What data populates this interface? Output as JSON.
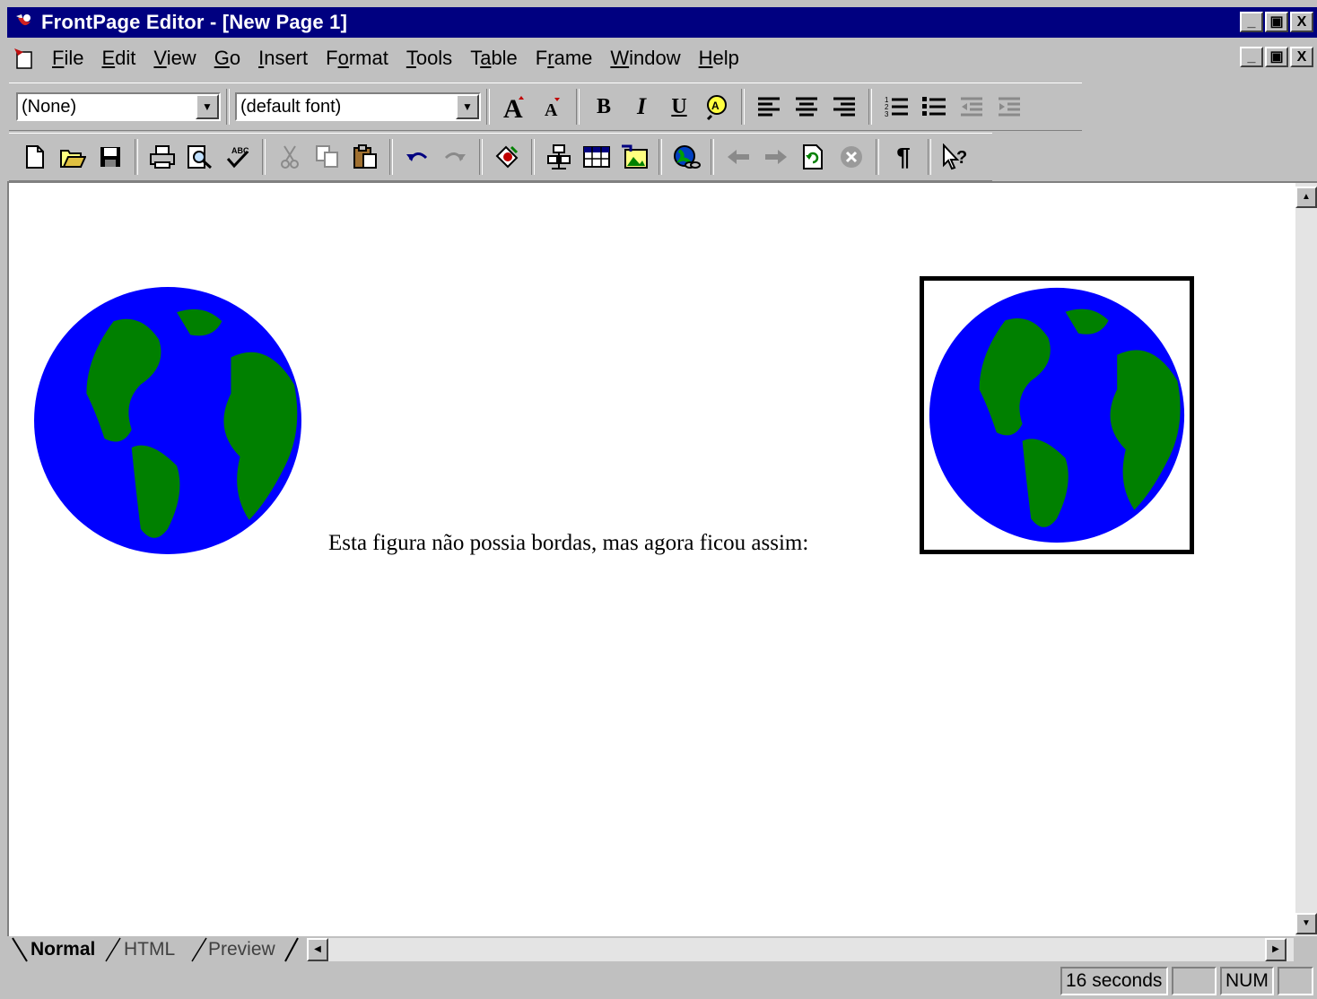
{
  "window": {
    "title": "FrontPage Editor - [New Page 1]",
    "controls": {
      "minimize": "_",
      "restore": "▣",
      "close": "X"
    }
  },
  "menu": {
    "items": [
      {
        "label": "File",
        "key": "F",
        "rest": "ile"
      },
      {
        "label": "Edit",
        "key": "E",
        "rest": "dit"
      },
      {
        "label": "View",
        "key": "V",
        "rest": "iew"
      },
      {
        "label": "Go",
        "key": "G",
        "rest": "o"
      },
      {
        "label": "Insert",
        "key": "I",
        "rest": "nsert"
      },
      {
        "label": "Format",
        "pre": "F",
        "key": "o",
        "rest": "rmat"
      },
      {
        "label": "Tools",
        "key": "T",
        "rest": "ools"
      },
      {
        "label": "Table",
        "pre": "T",
        "key": "a",
        "rest": "ble"
      },
      {
        "label": "Frame",
        "pre": "F",
        "key": "r",
        "rest": "ame"
      },
      {
        "label": "Window",
        "key": "W",
        "rest": "indow"
      },
      {
        "label": "Help",
        "key": "H",
        "rest": "elp"
      }
    ]
  },
  "format_toolbar": {
    "style_value": "(None)",
    "font_value": "(default font)",
    "bold": "B",
    "italic": "I",
    "underline": "U"
  },
  "icons": {
    "increase_font": "A˄",
    "decrease_font": "A˅",
    "new": "🗋",
    "paragraph": "¶",
    "help": "↖?"
  },
  "document": {
    "text": "Esta figura não possia bordas, mas agora ficou assim:",
    "globe_colors": {
      "ocean": "#0000ff",
      "land": "#008000"
    }
  },
  "view_tabs": [
    {
      "label": "Normal",
      "active": true
    },
    {
      "label": "HTML",
      "active": false
    },
    {
      "label": "Preview",
      "active": false
    }
  ],
  "status": {
    "download_time": "16 seconds",
    "num_lock": "NUM"
  }
}
